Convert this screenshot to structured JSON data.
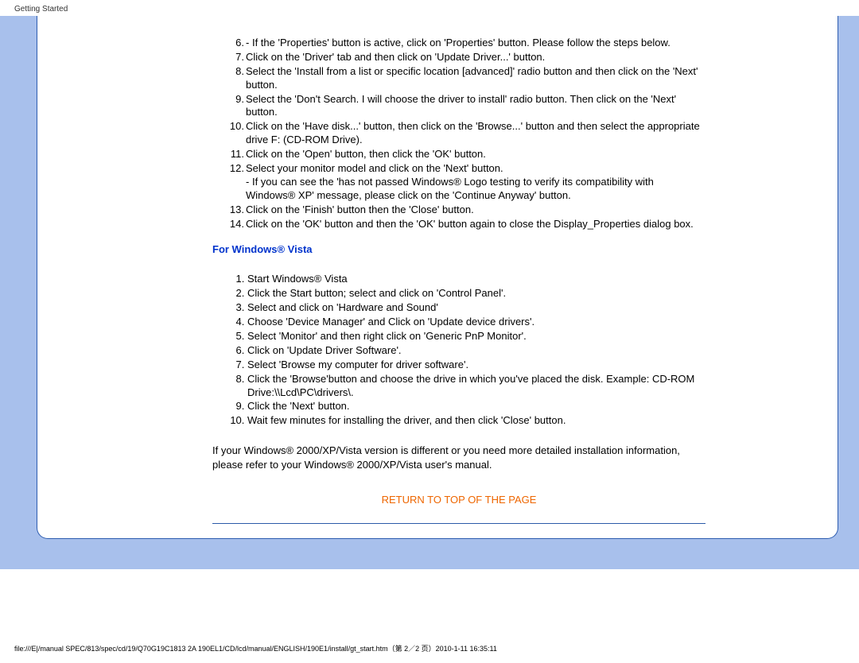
{
  "header_label": "Getting Started",
  "xp_steps": {
    "step6_note": "If the 'Properties' button is active, click on 'Properties' button. Please follow the steps below.",
    "step7": "Click on the 'Driver' tab and then click on 'Update Driver...' button.",
    "step8": "Select the 'Install from a list or specific location [advanced]' radio button and then click on the 'Next' button.",
    "step9": "Select the 'Don't Search. I will choose the driver to install' radio button. Then click on the 'Next' button.",
    "step10": "Click on the 'Have disk...' button, then click on the 'Browse...' button and then select the appropriate drive F: (CD-ROM Drive).",
    "step11": "Click on the 'Open' button, then click the 'OK' button.",
    "step12": "Select your monitor model and click on the 'Next' button.",
    "step12_note": "If you can see the 'has not passed Windows® Logo testing to verify its compatibility with Windows® XP' message, please click on the 'Continue Anyway' button.",
    "step13": "Click on the 'Finish' button then the 'Close' button.",
    "step14": "Click on the 'OK' button and then the 'OK' button again to close the Display_Properties dialog box."
  },
  "vista_title": "For Windows® Vista",
  "vista_steps": [
    "Start Windows® Vista",
    "Click the Start button; select and click on 'Control Panel'.",
    "Select and click on 'Hardware and Sound'",
    "Choose 'Device Manager' and Click on 'Update device drivers'.",
    "Select 'Monitor' and then right click on 'Generic PnP Monitor'.",
    "Click on 'Update Driver Software'.",
    "Select 'Browse my computer for driver software'.",
    "Click the 'Browse'button and choose the drive in which you've placed the disk. Example: CD-ROM Drive:\\\\Lcd\\PC\\drivers\\.",
    "Click the 'Next' button.",
    "Wait few minutes for installing the driver, and then click 'Close' button."
  ],
  "closing_para": "If your Windows® 2000/XP/Vista version is different or you need more detailed installation information, please refer to your Windows® 2000/XP/Vista user's manual.",
  "return_link": "RETURN TO TOP OF THE PAGE",
  "footer_path": "file:///E|/manual SPEC/813/spec/cd/19/Q70G19C1813 2A 190EL1/CD/lcd/manual/ENGLISH/190E1/install/gt_start.htm（第 2／2 页）2010-1-11 16:35:11"
}
